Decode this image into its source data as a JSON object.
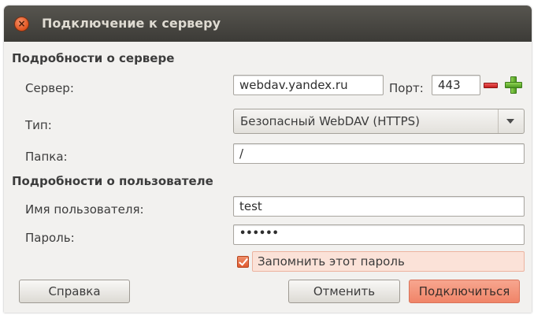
{
  "window": {
    "title": "Подключение к серверу"
  },
  "server_section": {
    "heading": "Подробности о сервере",
    "server_label": "Сервер:",
    "server_value": "webdav.yandex.ru",
    "port_label": "Порт:",
    "port_value": "443",
    "type_label": "Тип:",
    "type_value": "Безопасный WebDAV (HTTPS)",
    "folder_label": "Папка:",
    "folder_value": "/"
  },
  "user_section": {
    "heading": "Подробности о пользователе",
    "username_label": "Имя пользователя:",
    "username_value": "test",
    "password_label": "Пароль:",
    "password_value": "••••••",
    "remember_label": "Запомнить этот пароль",
    "remember_checked": true
  },
  "buttons": {
    "help": "Справка",
    "cancel": "Отменить",
    "connect": "Подключиться"
  },
  "icons": {
    "close": "close-icon",
    "decrement": "minus-icon",
    "increment": "plus-icon",
    "dropdown": "chevron-down-icon"
  },
  "colors": {
    "accent": "#f08468",
    "titlebar": "#3c3b37"
  }
}
